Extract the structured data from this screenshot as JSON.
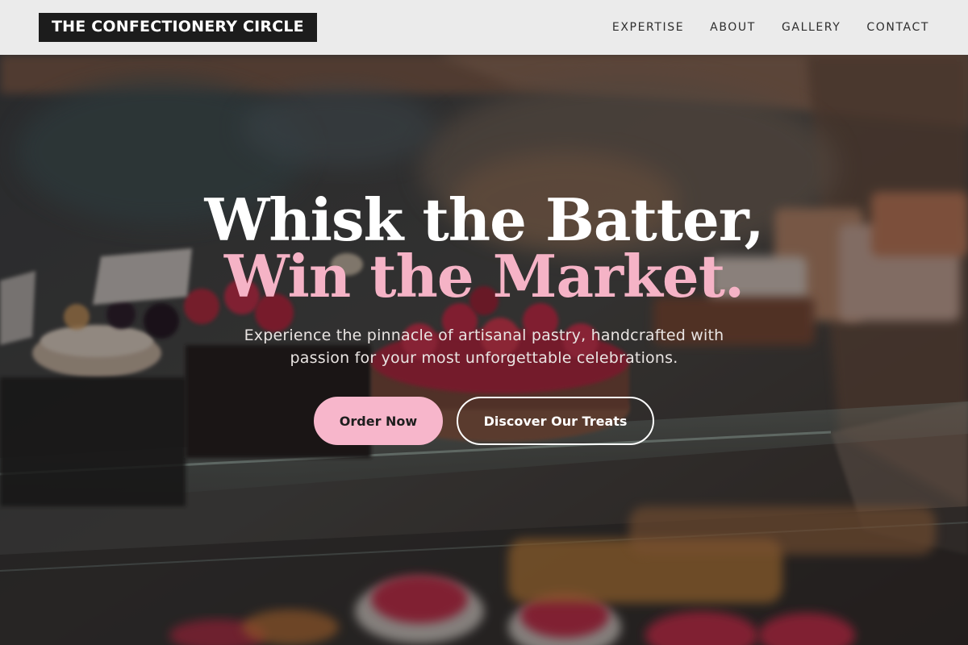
{
  "brand": {
    "logo_text": "THE CONFECTIONERY CIRCLE"
  },
  "nav": {
    "items": [
      {
        "label": "EXPERTISE"
      },
      {
        "label": "ABOUT"
      },
      {
        "label": "GALLERY"
      },
      {
        "label": "CONTACT"
      }
    ]
  },
  "hero": {
    "headline_line1": "Whisk the Batter,",
    "headline_line2": "Win the Market.",
    "subtitle": "Experience the pinnacle of artisanal pastry, handcrafted with passion for your most unforgettable celebrations.",
    "primary_button_label": "Order Now",
    "secondary_button_label": "Discover Our Treats",
    "background_image": "blurred-pastry-display-case-photo"
  },
  "colors": {
    "header_bg": "#ebebeb",
    "logo_bg": "#1c1c1c",
    "accent_pink": "#f5b3c6",
    "headline_white": "#ffffff"
  }
}
